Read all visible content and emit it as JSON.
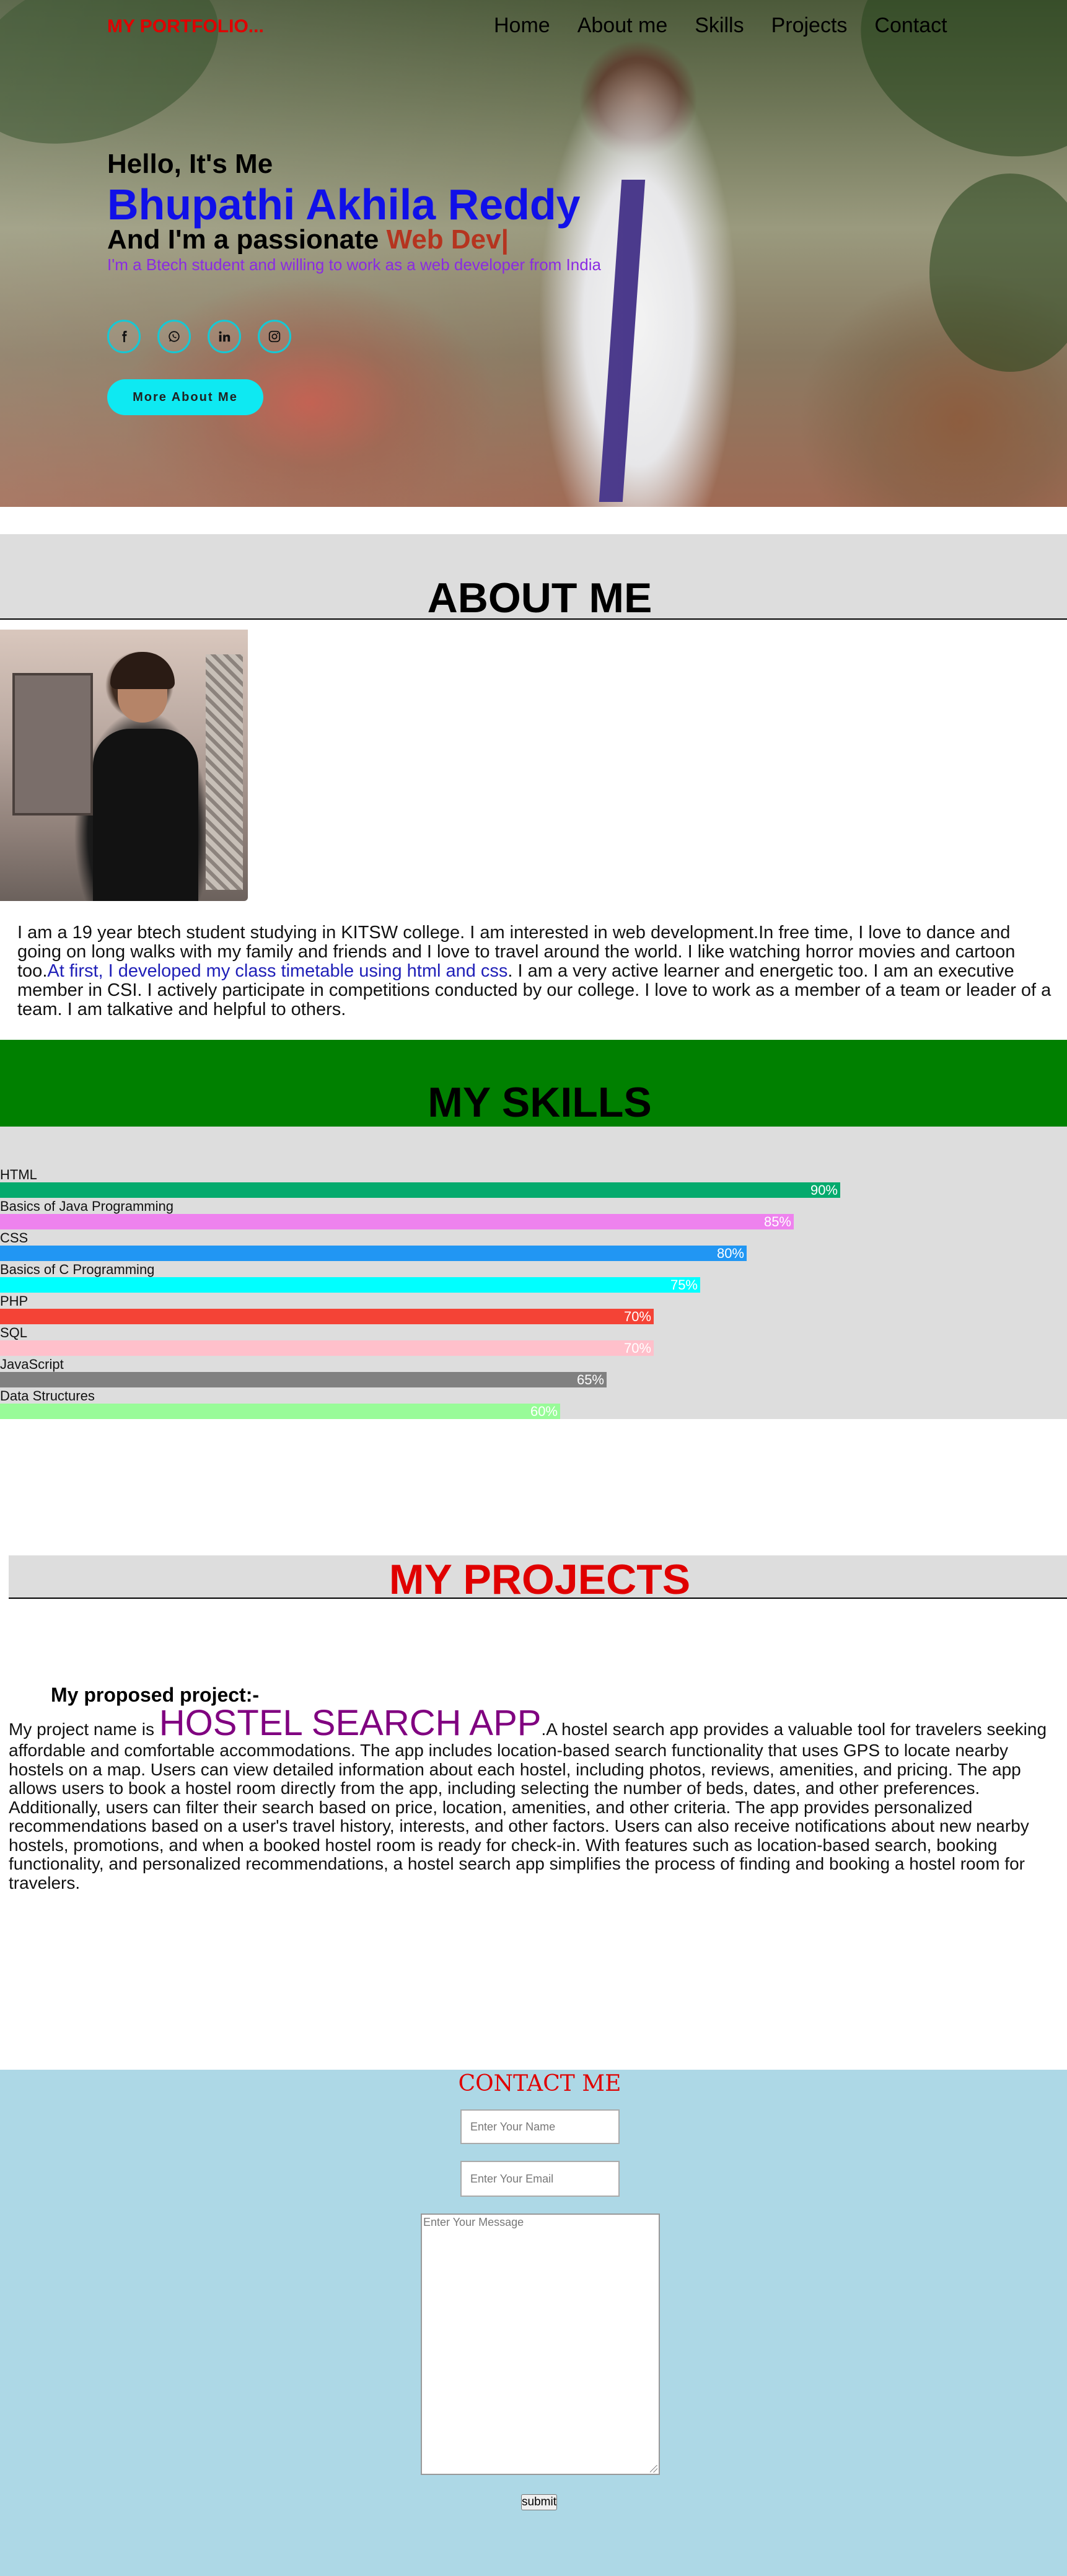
{
  "nav": {
    "logo": "MY PORTFOLIO...",
    "links": [
      "Home",
      "About me",
      "Skills",
      "Projects",
      "Contact"
    ]
  },
  "hero": {
    "greeting": "Hello, It's Me",
    "name": "Bhupathi Akhila Reddy",
    "role_prefix": "And I'm a passionate ",
    "role_highlight": "Web Dev|",
    "intro": "I'm a Btech student and willing to work as a web developer from India",
    "socials": [
      "facebook-icon",
      "whatsapp-icon",
      "linkedin-icon",
      "instagram-icon"
    ],
    "cta": "More About Me"
  },
  "about": {
    "title": "ABOUT ME",
    "text_part1": "I am a 19 year btech student studying in KITSW college. I am interested in web development.In free time, I love to dance and going on long walks with my family and friends and I love to travel around the world. I like watching horror movies and cartoon too.",
    "text_highlight": "At first, I developed my class timetable using html and css",
    "text_part2": ". I am a very active learner and energetic too. I am an executive member in CSI. I actively participate in competitions conducted by our college. I love to work as a member of a team or leader of a team. I am talkative and helpful to others."
  },
  "skills": {
    "title": "MY SKILLS",
    "items": [
      {
        "label": "HTML",
        "percent": "90%",
        "value": 90,
        "color": "#04aa6d"
      },
      {
        "label": "Basics of Java Programming",
        "percent": "85%",
        "value": 85,
        "color": "#ee82ee"
      },
      {
        "label": "CSS",
        "percent": "80%",
        "value": 80,
        "color": "#2196f3"
      },
      {
        "label": "Basics of C Programming",
        "percent": "75%",
        "value": 75,
        "color": "#00ffff"
      },
      {
        "label": "PHP",
        "percent": "70%",
        "value": 70,
        "color": "#f44336"
      },
      {
        "label": "SQL",
        "percent": "70%",
        "value": 70,
        "color": "#ffc0cb"
      },
      {
        "label": "JavaScript",
        "percent": "65%",
        "value": 65,
        "color": "#808080"
      },
      {
        "label": "Data Structures",
        "percent": "60%",
        "value": 60,
        "color": "#98fb98"
      }
    ]
  },
  "projects": {
    "title": "MY PROJECTS",
    "subtitle": "My proposed project:-",
    "intro": "My project name is ",
    "app_name": "HOSTEL SEARCH APP",
    "description": ".A hostel search app provides a valuable tool for travelers seeking affordable and comfortable accommodations. The app includes location-based search functionality that uses GPS to locate nearby hostels on a map. Users can view detailed information about each hostel, including photos, reviews, amenities, and pricing. The app allows users to book a hostel room directly from the app, including selecting the number of beds, dates, and other preferences. Additionally, users can filter their search based on price, location, amenities, and other criteria. The app provides personalized recommendations based on a user's travel history, interests, and other factors. Users can also receive notifications about new nearby hostels, promotions, and when a booked hostel room is ready for check-in. With features such as location-based search, booking functionality, and personalized recommendations, a hostel search app simplifies the process of finding and booking a hostel room for travelers."
  },
  "contact": {
    "title": "CONTACT ME",
    "name_placeholder": "Enter Your Name",
    "email_placeholder": "Enter Your Email",
    "message_placeholder": "Enter Your Message",
    "submit": "submit"
  }
}
